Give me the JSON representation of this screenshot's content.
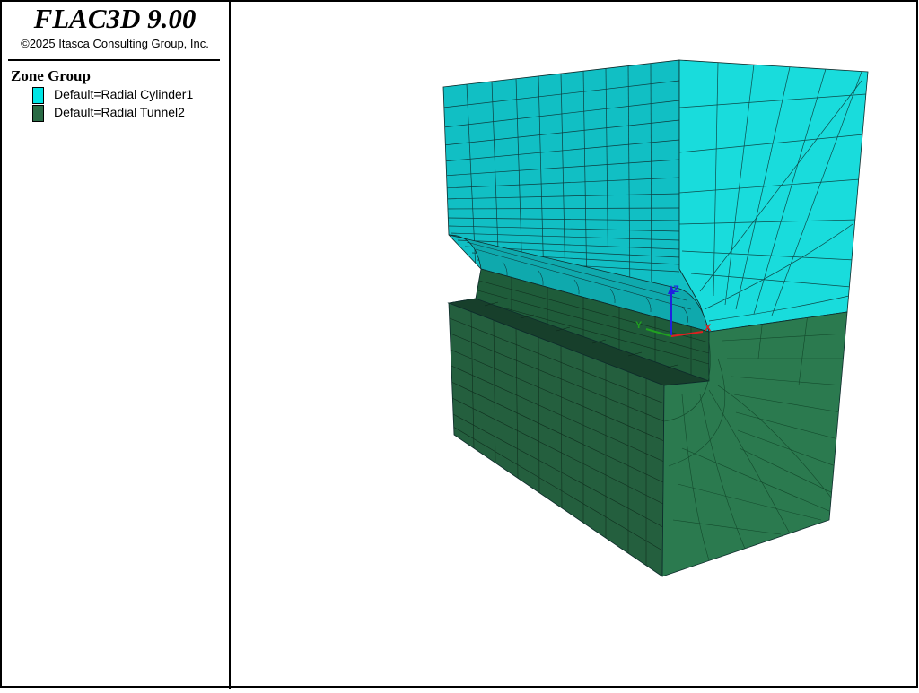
{
  "app": {
    "title": "FLAC3D 9.00",
    "copyright": "©2025 Itasca Consulting Group, Inc."
  },
  "legend": {
    "heading": "Zone Group",
    "items": [
      {
        "label": "Default=Radial Cylinder1",
        "color": "#00e5e5"
      },
      {
        "label": "Default=Radial Tunnel2",
        "color": "#2a6b45"
      }
    ]
  },
  "axes": {
    "x": "X",
    "y": "Y",
    "z": "Z"
  },
  "colors": {
    "cylinder_top": "#10b8bd",
    "cylinder_side": "#16d8d8",
    "tunnel_front": "#225f3d",
    "tunnel_side": "#2a7a4e",
    "tunnel_groove": "#193f2c",
    "mesh_line": "#0d2b2b",
    "axis_x": "#e02020",
    "axis_y": "#20a020",
    "axis_z": "#2020e0"
  }
}
